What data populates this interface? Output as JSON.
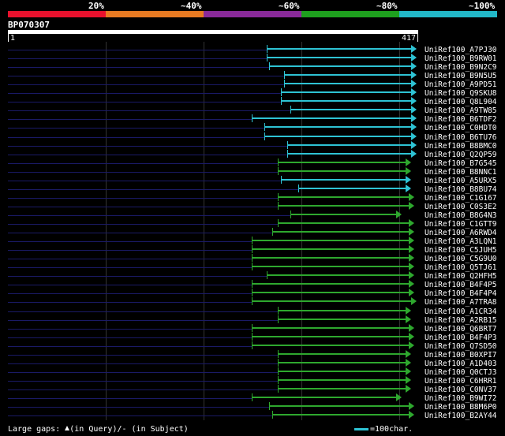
{
  "legend": {
    "labels": [
      "20%",
      "~40%",
      "~60%",
      "~80%",
      "~100%"
    ],
    "colors": [
      "#e8112d",
      "#e87a22",
      "#8a2a9a",
      "#1ea01e",
      "#22b8c8"
    ]
  },
  "query": {
    "id": "BP070307",
    "start": "1",
    "end": "417"
  },
  "hits": [
    {
      "name": "UniRef100_A7PJ30",
      "start": 0.633,
      "end": 0.997,
      "color": "teal"
    },
    {
      "name": "UniRef100_B9RW01",
      "start": 0.633,
      "end": 0.997,
      "color": "teal"
    },
    {
      "name": "UniRef100_B9N2C9",
      "start": 0.639,
      "end": 0.997,
      "color": "teal"
    },
    {
      "name": "UniRef100_B9N5U5",
      "start": 0.675,
      "end": 0.997,
      "color": "teal"
    },
    {
      "name": "UniRef100_A9PD51",
      "start": 0.675,
      "end": 0.997,
      "color": "teal"
    },
    {
      "name": "UniRef100_Q9SKU8",
      "start": 0.668,
      "end": 0.997,
      "color": "teal"
    },
    {
      "name": "UniRef100_Q8L904",
      "start": 0.668,
      "end": 0.997,
      "color": "teal"
    },
    {
      "name": "UniRef100_A9TW85",
      "start": 0.69,
      "end": 0.997,
      "color": "teal"
    },
    {
      "name": "UniRef100_B6TDF2",
      "start": 0.596,
      "end": 0.997,
      "color": "teal"
    },
    {
      "name": "UniRef100_C0HDT0",
      "start": 0.627,
      "end": 0.997,
      "color": "teal"
    },
    {
      "name": "UniRef100_B6TU76",
      "start": 0.627,
      "end": 0.997,
      "color": "teal"
    },
    {
      "name": "UniRef100_B8BMC0",
      "start": 0.683,
      "end": 0.997,
      "color": "teal"
    },
    {
      "name": "UniRef100_Q2QP59",
      "start": 0.683,
      "end": 0.997,
      "color": "teal"
    },
    {
      "name": "UniRef100_B7G545",
      "start": 0.66,
      "end": 0.983,
      "color": "green"
    },
    {
      "name": "UniRef100_B8NNC1",
      "start": 0.66,
      "end": 0.983,
      "color": "green"
    },
    {
      "name": "UniRef100_A5URX5",
      "start": 0.668,
      "end": 0.983,
      "color": "teal"
    },
    {
      "name": "UniRef100_B8BU74",
      "start": 0.71,
      "end": 0.983,
      "color": "teal"
    },
    {
      "name": "UniRef100_C1G167",
      "start": 0.66,
      "end": 0.99,
      "color": "green"
    },
    {
      "name": "UniRef100_C0S3E2",
      "start": 0.66,
      "end": 0.99,
      "color": "green"
    },
    {
      "name": "UniRef100_B8G4N3",
      "start": 0.69,
      "end": 0.96,
      "color": "green"
    },
    {
      "name": "UniRef100_C1GTT9",
      "start": 0.66,
      "end": 0.99,
      "color": "green"
    },
    {
      "name": "UniRef100_A6RWD4",
      "start": 0.647,
      "end": 0.99,
      "color": "green"
    },
    {
      "name": "UniRef100_A3LQN1",
      "start": 0.596,
      "end": 0.99,
      "color": "green"
    },
    {
      "name": "UniRef100_C5JUH5",
      "start": 0.596,
      "end": 0.99,
      "color": "green"
    },
    {
      "name": "UniRef100_C5G9U0",
      "start": 0.596,
      "end": 0.99,
      "color": "green"
    },
    {
      "name": "UniRef100_Q5TJ61",
      "start": 0.596,
      "end": 0.99,
      "color": "green"
    },
    {
      "name": "UniRef100_Q2HFH5",
      "start": 0.633,
      "end": 0.99,
      "color": "green"
    },
    {
      "name": "UniRef100_B4F4P5",
      "start": 0.596,
      "end": 0.99,
      "color": "green"
    },
    {
      "name": "UniRef100_B4F4P4",
      "start": 0.596,
      "end": 0.99,
      "color": "green"
    },
    {
      "name": "UniRef100_A7TRA8",
      "start": 0.596,
      "end": 0.997,
      "color": "green"
    },
    {
      "name": "UniRef100_A1CR34",
      "start": 0.66,
      "end": 0.983,
      "color": "green"
    },
    {
      "name": "UniRef100_A2RB15",
      "start": 0.66,
      "end": 0.983,
      "color": "green"
    },
    {
      "name": "UniRef100_Q6BRT7",
      "start": 0.596,
      "end": 0.99,
      "color": "green"
    },
    {
      "name": "UniRef100_B4F4P3",
      "start": 0.596,
      "end": 0.99,
      "color": "green"
    },
    {
      "name": "UniRef100_Q7SD50",
      "start": 0.596,
      "end": 0.99,
      "color": "green"
    },
    {
      "name": "UniRef100_B0XPI7",
      "start": 0.66,
      "end": 0.983,
      "color": "green"
    },
    {
      "name": "UniRef100_A1D403",
      "start": 0.66,
      "end": 0.983,
      "color": "green"
    },
    {
      "name": "UniRef100_Q0CTJ3",
      "start": 0.66,
      "end": 0.983,
      "color": "green"
    },
    {
      "name": "UniRef100_C6HRR1",
      "start": 0.66,
      "end": 0.983,
      "color": "green"
    },
    {
      "name": "UniRef100_C0NV37",
      "start": 0.66,
      "end": 0.983,
      "color": "green"
    },
    {
      "name": "UniRef100_B9WI72",
      "start": 0.596,
      "end": 0.96,
      "color": "green"
    },
    {
      "name": "UniRef100_B8M6P0",
      "start": 0.639,
      "end": 0.99,
      "color": "green"
    },
    {
      "name": "UniRef100_B2AY44",
      "start": 0.647,
      "end": 0.99,
      "color": "green"
    }
  ],
  "footer": {
    "gaps_prefix": "Large gaps:",
    "gaps_query": "(in Query)/",
    "gaps_subject": "- (in Subject)",
    "scale_label": "=100char."
  }
}
